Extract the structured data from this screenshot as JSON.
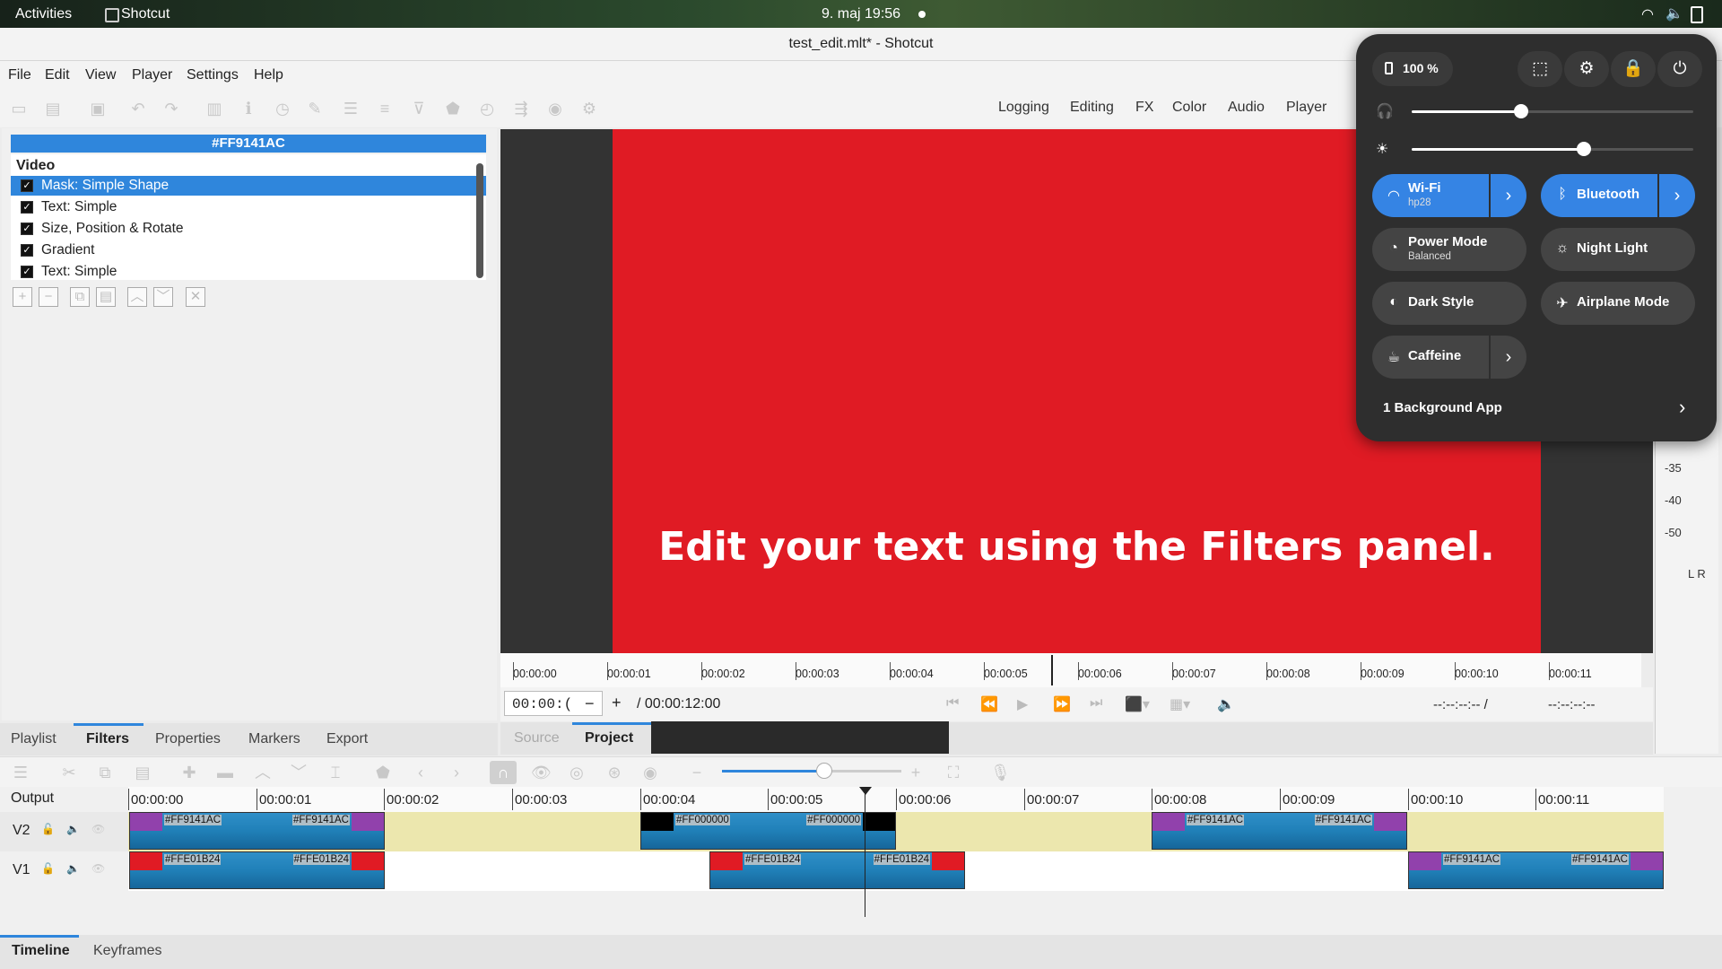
{
  "topbar": {
    "activities": "Activities",
    "app": "Shotcut",
    "clock": "9. maj  19:56"
  },
  "window": {
    "title": "test_edit.mlt* - Shotcut"
  },
  "menu": [
    "File",
    "Edit",
    "View",
    "Player",
    "Settings",
    "Help"
  ],
  "layouts": [
    "Logging",
    "Editing",
    "FX",
    "Color",
    "Audio",
    "Player"
  ],
  "filters": {
    "header": "#FF9141AC",
    "group": "Video",
    "items": [
      "Mask: Simple Shape",
      "Text: Simple",
      "Size, Position & Rotate",
      "Gradient",
      "Text: Simple"
    ]
  },
  "left_tabs": [
    "Playlist",
    "Filters",
    "Properties",
    "Markers",
    "Export"
  ],
  "preview": {
    "overlay_text": "Edit your text using the Filters panel.",
    "ruler": [
      "00:00:00",
      "00:00:01",
      "00:00:02",
      "00:00:03",
      "00:00:04",
      "00:00:05",
      "00:00:06",
      "00:00:07",
      "00:00:08",
      "00:00:09",
      "00:00:10",
      "00:00:11"
    ],
    "timecode": "00:00:(",
    "duration": "/ 00:00:12:00",
    "in_point": "--:--:--:-- /",
    "out_point": "--:--:--:--",
    "minus": "−",
    "plus": "+"
  },
  "source_project": {
    "source": "Source",
    "project": "Project"
  },
  "meter": {
    "labels": [
      "-35",
      "-40",
      "-50"
    ],
    "lr": "L R"
  },
  "timeline": {
    "output": "Output",
    "tracks": [
      "V2",
      "V1"
    ],
    "ruler": [
      "00:00:00",
      "00:00:01",
      "00:00:02",
      "00:00:03",
      "00:00:04",
      "00:00:05",
      "00:00:06",
      "00:00:07",
      "00:00:08",
      "00:00:09",
      "00:00:10",
      "00:00:11"
    ],
    "clip_labels": {
      "purple": "#FF9141AC",
      "black": "#FF000000",
      "red": "#FFE01B24"
    }
  },
  "bottom_tabs": [
    "Timeline",
    "Keyframes"
  ],
  "quick_settings": {
    "battery": "100 %",
    "volume_level": 0.39,
    "brightness_level": 0.61,
    "wifi": {
      "label": "Wi-Fi",
      "sub": "hp28"
    },
    "bluetooth": "Bluetooth",
    "power_mode": {
      "label": "Power Mode",
      "sub": "Balanced"
    },
    "night_light": "Night Light",
    "dark_style": "Dark Style",
    "airplane": "Airplane Mode",
    "caffeine": "Caffeine",
    "background_apps": "1 Background App"
  },
  "colors": {
    "accent": "#3584e4",
    "selection": "#2f86dc",
    "preview_red": "#e01b24",
    "clip_purple": "#9141ac"
  }
}
